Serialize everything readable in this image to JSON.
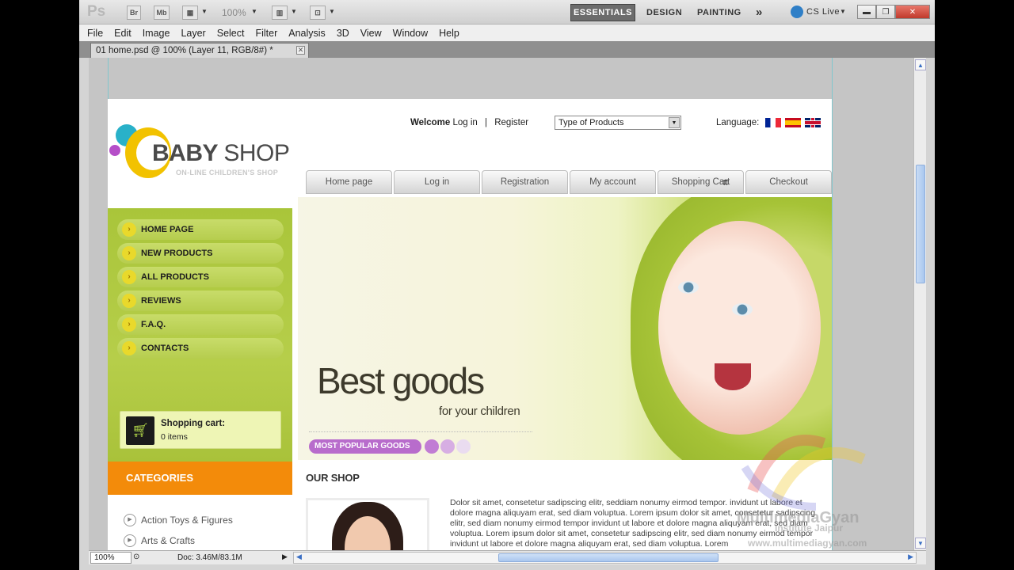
{
  "app": {
    "logo": "Ps",
    "toolbar": {
      "br": "Br",
      "mb": "Mb",
      "zoom": "100%"
    },
    "workspaces": {
      "active": "ESSENTIALS",
      "design": "DESIGN",
      "painting": "PAINTING",
      "more": "»"
    },
    "cslive": "CS Live"
  },
  "menu": [
    "File",
    "Edit",
    "Image",
    "Layer",
    "Select",
    "Filter",
    "Analysis",
    "3D",
    "View",
    "Window",
    "Help"
  ],
  "document": {
    "tab_title": "01 home.psd @ 100% (Layer 11, RGB/8#) *"
  },
  "status": {
    "zoom": "100%",
    "doc_size": "Doc: 3.46M/83.1M"
  },
  "site": {
    "logo_main_bold": "BABY",
    "logo_main": "SHOP",
    "logo_sub": "ON-LINE CHILDREN'S SHOP",
    "welcome_bold": "Welcome",
    "login": "Log in",
    "separator": "|",
    "register": "Register",
    "type_select": "Type of Products",
    "language_label": "Language:",
    "nav": [
      "Home page",
      "Log in",
      "Registration",
      "My account",
      "Shopping Cart",
      "Checkout"
    ],
    "sidebar": [
      "HOME PAGE",
      "NEW PRODUCTS",
      "ALL PRODUCTS",
      "REVIEWS",
      "F.A.Q.",
      "CONTACTS"
    ],
    "cart_title": "Shopping cart:",
    "cart_items": "0 items",
    "categories_title": "CATEGORIES",
    "categories": [
      "Action Toys & Figures",
      "Arts & Crafts"
    ],
    "hero_title": "Best goods",
    "hero_sub": "for your children",
    "popular_label": "MOST POPULAR GOODS",
    "our_shop": "OUR SHOP",
    "shop_text": "Dolor sit amet, consetetur sadipscing elitr, seddiam nonumy eirmod tempor. invidunt ut labore et dolore magna aliquyam erat, sed diam voluptua. Lorem ipsum dolor sit amet, consetetur sadipscing elitr, sed diam nonumy eirmod tempor invidunt ut labore et dolore magna aliquyam erat, sed diam voluptua. Lorem ipsum dolor sit amet, consetetur sadipscing elitr, sed diam nonumy eirmod tempor invidunt ut labore et dolore magna aliquyam erat, sed diam voluptua. Lorem"
  },
  "watermark": {
    "brand": "MultimediaGyan",
    "line1": "Institute Jaipur",
    "line2": "www.multimediagyan.com"
  },
  "colors": {
    "green": "#a9c53a",
    "orange": "#f38b0a",
    "purple": "#b86ccc",
    "ps_active": "#6c6c6c"
  }
}
